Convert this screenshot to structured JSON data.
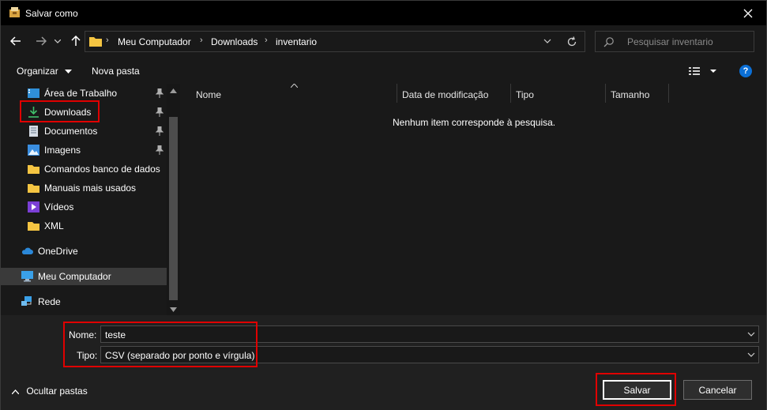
{
  "window": {
    "title": "Salvar como"
  },
  "address": {
    "crumbs": [
      "Meu Computador",
      "Downloads",
      "inventario"
    ],
    "search_placeholder": "Pesquisar inventario"
  },
  "toolbar": {
    "organize_label": "Organizar",
    "new_folder_label": "Nova pasta",
    "help_label": "?"
  },
  "sidebar": {
    "items": [
      {
        "label": "Área de Trabalho",
        "icon": "desktop-icon",
        "pinned": true
      },
      {
        "label": "Downloads",
        "icon": "download-icon",
        "pinned": true
      },
      {
        "label": "Documentos",
        "icon": "document-icon",
        "pinned": true
      },
      {
        "label": "Imagens",
        "icon": "image-icon",
        "pinned": true
      },
      {
        "label": "Comandos banco de dados",
        "icon": "folder-icon",
        "pinned": false
      },
      {
        "label": "Manuais mais usados",
        "icon": "folder-icon",
        "pinned": false
      },
      {
        "label": "Vídeos",
        "icon": "video-icon",
        "pinned": false
      },
      {
        "label": "XML",
        "icon": "folder-icon",
        "pinned": false
      },
      {
        "label": "OneDrive",
        "icon": "cloud-icon",
        "pinned": false
      },
      {
        "label": "Meu Computador",
        "icon": "computer-icon",
        "pinned": false,
        "selected": true
      },
      {
        "label": "Rede",
        "icon": "network-icon",
        "pinned": false
      }
    ]
  },
  "content": {
    "columns": [
      "Nome",
      "Data de modificação",
      "Tipo",
      "Tamanho"
    ],
    "empty_message": "Nenhum item corresponde à pesquisa."
  },
  "form": {
    "name_label": "Nome:",
    "name_value": "teste",
    "type_label": "Tipo:",
    "type_value": "CSV (separado por ponto e vírgula)"
  },
  "footer": {
    "hide_folders_label": "Ocultar pastas",
    "save_label": "Salvar",
    "cancel_label": "Cancelar"
  },
  "colors": {
    "highlight": "#e00000",
    "accent": "#0b6fd6",
    "folder": "#f5c542"
  }
}
